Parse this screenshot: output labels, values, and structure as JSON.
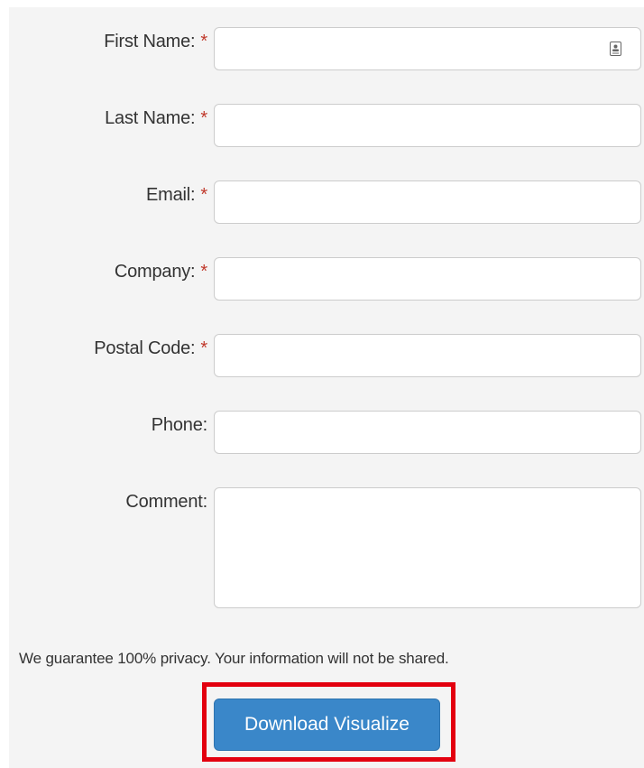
{
  "form": {
    "fields": [
      {
        "label": "First Name:",
        "required_mark": "*",
        "value": ""
      },
      {
        "label": "Last Name:",
        "required_mark": "*",
        "value": ""
      },
      {
        "label": "Email:",
        "required_mark": "*",
        "value": ""
      },
      {
        "label": "Company:",
        "required_mark": "*",
        "value": ""
      },
      {
        "label": "Postal Code:",
        "required_mark": "*",
        "value": ""
      },
      {
        "label": "Phone:",
        "value": ""
      },
      {
        "label": "Comment:",
        "value": ""
      }
    ],
    "privacy_note": "We guarantee 100% privacy. Your information will not be shared.",
    "submit_label": "Download Visualize"
  },
  "icons": {
    "first_name_field_icon": "contact-card-icon"
  },
  "colors": {
    "required_mark": "#c0392b",
    "button_bg": "#3a87c9",
    "highlight_border": "#e3000f",
    "panel_bg": "#f4f4f4"
  }
}
